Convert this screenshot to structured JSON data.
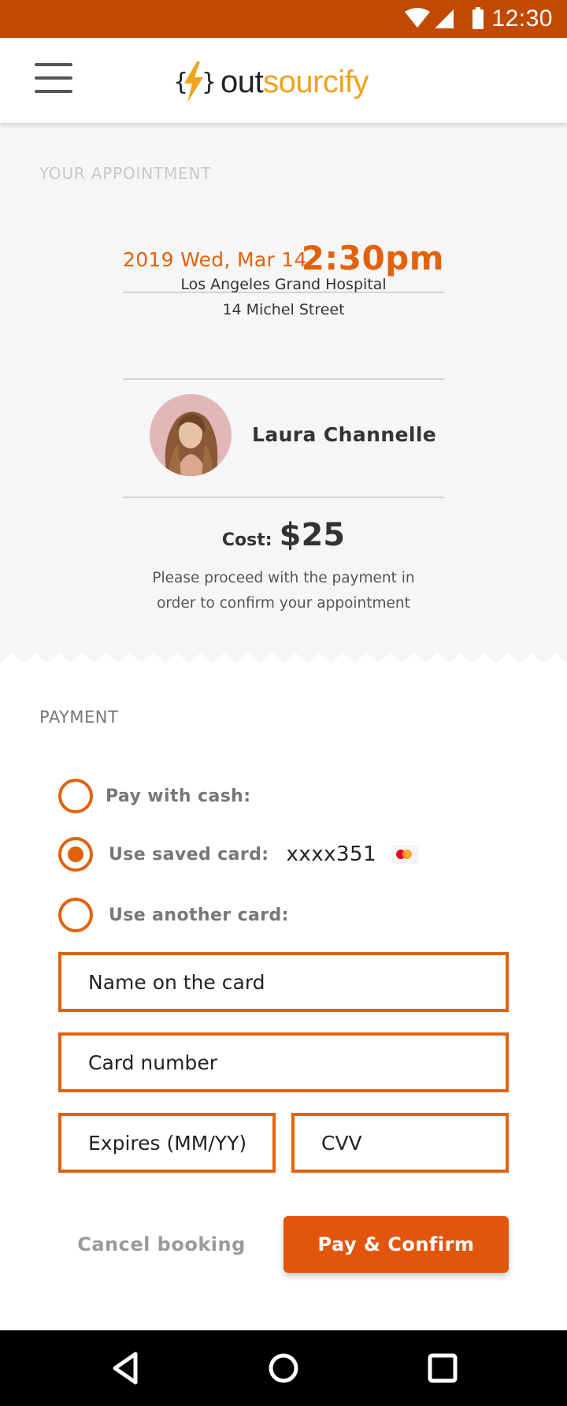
{
  "status_bar": {
    "time": "12:30"
  },
  "header": {
    "brand_part1": "out",
    "brand_part2": "sourcify"
  },
  "appointment": {
    "heading": "YOUR APPOINTMENT",
    "date": "2019 Wed, Mar 14",
    "time": "2:30pm",
    "hospital_name": "Los Angeles Grand Hospital",
    "hospital_address": "14 Michel Street",
    "doctor_name": "Laura Channelle",
    "cost_label": "Cost:",
    "cost_value": "$25",
    "note_line1": "Please proceed with the payment in",
    "note_line2": "order to confirm your appointment"
  },
  "payment": {
    "heading": "PAYMENT",
    "options": [
      {
        "label": "Pay with cash:",
        "selected": false
      },
      {
        "label": "Use saved card:",
        "selected": true,
        "card_number": "xxxx351"
      },
      {
        "label": "Use another card:",
        "selected": false
      }
    ],
    "fields": {
      "name_placeholder": "Name on the card",
      "number_placeholder": "Card number",
      "expires_placeholder": "Expires (MM/YY)",
      "cvv_placeholder": "CVV"
    },
    "cancel_label": "Cancel booking",
    "confirm_label": "Pay & Confirm"
  },
  "colors": {
    "status_bar": "#c24a00",
    "accent": "#e2620c",
    "brand_yellow": "#f0a31d",
    "appointment_bg": "#f6f6f6"
  },
  "icons": [
    "wifi-icon",
    "signal-icon",
    "battery-icon",
    "menu-icon",
    "logo-bolt-icon",
    "mastercard-icon",
    "back-icon",
    "home-icon",
    "recents-icon"
  ]
}
